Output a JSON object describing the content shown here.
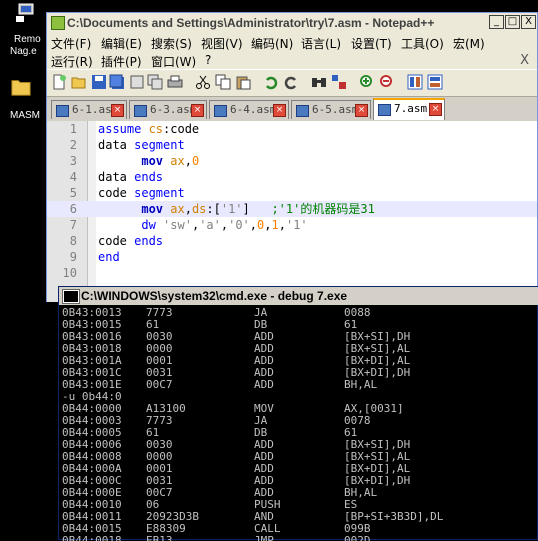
{
  "desktop": {
    "icons": [
      {
        "label": "Remo",
        "icon": "shortcut-icon"
      },
      {
        "label": "Nag.e",
        "icon": ""
      },
      {
        "label": "MASM",
        "icon": "folder-icon"
      }
    ]
  },
  "notepad": {
    "title": "C:\\Documents and Settings\\Administrator\\try\\7.asm - Notepad++",
    "window_buttons": {
      "minimize": "_",
      "maximize": "□",
      "close": "X"
    },
    "menu_row1": [
      "文件(F)",
      "编辑(E)",
      "搜索(S)",
      "视图(V)",
      "编码(N)",
      "语言(L)",
      "设置(T)",
      "工具(O)",
      "宏(M)"
    ],
    "menu_row2": [
      "运行(R)",
      "插件(P)",
      "窗口(W)",
      "?"
    ],
    "menu_close": "X",
    "tabs": [
      {
        "label": "6-1.asm",
        "active": false
      },
      {
        "label": "6-3.asm",
        "active": false
      },
      {
        "label": "6-4.asm",
        "active": false
      },
      {
        "label": "6-5.asm",
        "active": false
      },
      {
        "label": "7.asm",
        "active": true
      }
    ],
    "lines": [
      {
        "n": "1",
        "t": [
          [
            "kw",
            "assume "
          ],
          [
            "reg",
            "cs"
          ],
          [
            "pl",
            ":code"
          ]
        ]
      },
      {
        "n": "2",
        "t": [
          [
            "pl",
            "data "
          ],
          [
            "kw",
            "segment"
          ]
        ]
      },
      {
        "n": "3",
        "t": [
          [
            "pl",
            "      "
          ],
          [
            "ins",
            "mov "
          ],
          [
            "reg",
            "ax"
          ],
          [
            "pl",
            ","
          ],
          [
            "num2",
            "0"
          ]
        ]
      },
      {
        "n": "4",
        "t": [
          [
            "pl",
            "data "
          ],
          [
            "kw",
            "ends"
          ]
        ]
      },
      {
        "n": "5",
        "t": [
          [
            "pl",
            "code "
          ],
          [
            "kw",
            "segment"
          ]
        ]
      },
      {
        "n": "6",
        "t": [
          [
            "pl",
            "      "
          ],
          [
            "ins",
            "mov "
          ],
          [
            "reg",
            "ax"
          ],
          [
            "pl",
            ","
          ],
          [
            "reg",
            "ds"
          ],
          [
            "pl",
            ":["
          ],
          [
            "str",
            "'1'"
          ],
          [
            "pl",
            "]   "
          ],
          [
            "cm",
            ";'1'的机器码是31"
          ]
        ]
      },
      {
        "n": "7",
        "t": [
          [
            "pl",
            "      "
          ],
          [
            "kw",
            "dw "
          ],
          [
            "str",
            "'sw'"
          ],
          [
            "pl",
            ","
          ],
          [
            "str",
            "'a'"
          ],
          [
            "pl",
            ","
          ],
          [
            "str",
            "'0'"
          ],
          [
            "pl",
            ","
          ],
          [
            "num2",
            "0"
          ],
          [
            "pl",
            ","
          ],
          [
            "num2",
            "1"
          ],
          [
            "pl",
            ","
          ],
          [
            "str",
            "'1'"
          ]
        ]
      },
      {
        "n": "8",
        "t": [
          [
            "pl",
            "code "
          ],
          [
            "kw",
            "ends"
          ]
        ]
      },
      {
        "n": "9",
        "t": [
          [
            "kw",
            "end"
          ]
        ]
      },
      {
        "n": "10",
        "t": []
      }
    ]
  },
  "cmd": {
    "title": "C:\\WINDOWS\\system32\\cmd.exe - debug 7.exe",
    "rows": [
      [
        "0B43:0013",
        "7773",
        "JA",
        "0088"
      ],
      [
        "0B43:0015",
        "61",
        "DB",
        "61"
      ],
      [
        "0B43:0016",
        "0030",
        "ADD",
        "[BX+SI],DH"
      ],
      [
        "0B43:0018",
        "0000",
        "ADD",
        "[BX+SI],AL"
      ],
      [
        "0B43:001A",
        "0001",
        "ADD",
        "[BX+DI],AL"
      ],
      [
        "0B43:001C",
        "0031",
        "ADD",
        "[BX+DI],DH"
      ],
      [
        "0B43:001E",
        "00C7",
        "ADD",
        "BH,AL"
      ],
      [
        "-u 0b44:0",
        "",
        "",
        ""
      ],
      [
        "0B44:0000",
        "A13100",
        "MOV",
        "AX,[0031]"
      ],
      [
        "0B44:0003",
        "7773",
        "JA",
        "0078"
      ],
      [
        "0B44:0005",
        "61",
        "DB",
        "61"
      ],
      [
        "0B44:0006",
        "0030",
        "ADD",
        "[BX+SI],DH"
      ],
      [
        "0B44:0008",
        "0000",
        "ADD",
        "[BX+SI],AL"
      ],
      [
        "0B44:000A",
        "0001",
        "ADD",
        "[BX+DI],AL"
      ],
      [
        "0B44:000C",
        "0031",
        "ADD",
        "[BX+DI],DH"
      ],
      [
        "0B44:000E",
        "00C7",
        "ADD",
        "BH,AL"
      ],
      [
        "0B44:0010",
        "06",
        "PUSH",
        "ES"
      ],
      [
        "0B44:0011",
        "20923D3B",
        "AND",
        "[BP+SI+3B3D],DL"
      ],
      [
        "0B44:0015",
        "E88309",
        "CALL",
        "099B"
      ],
      [
        "0B44:0018",
        "EB13",
        "JMP",
        "002D"
      ]
    ]
  },
  "colors": {
    "cmd_text": "#c0c0c0",
    "keyword": "#0000ff",
    "register": "#d08000",
    "comment": "#008000"
  }
}
